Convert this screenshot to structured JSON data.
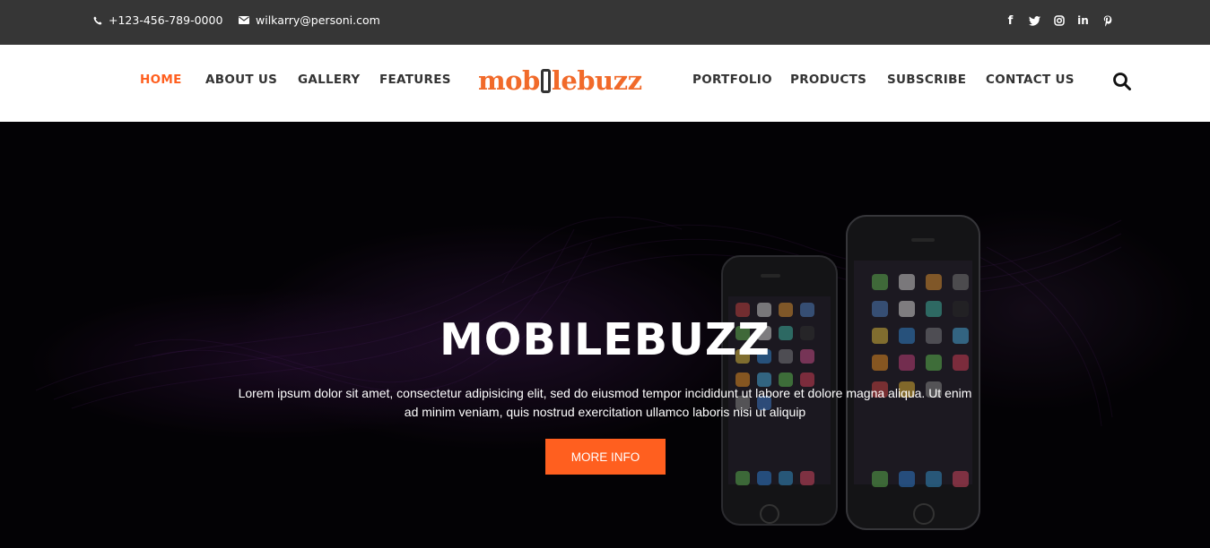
{
  "topbar": {
    "phone": "+123-456-789-0000",
    "email": "wilkarry@personi.com",
    "socials": [
      "facebook-icon",
      "twitter-icon",
      "instagram-icon",
      "linkedin-icon",
      "pinterest-icon"
    ],
    "background": "#363636"
  },
  "nav": {
    "left_items": [
      "HOME",
      "ABOUT US",
      "GALLERY",
      "FEATURES"
    ],
    "right_items": [
      "PORTFOLIO",
      "PRODUCTS",
      "SUBSCRIBE",
      "CONTACT US"
    ],
    "active": "HOME",
    "logo_left": "mob",
    "logo_right": "lebuzz",
    "search_icon": "search-icon"
  },
  "hero": {
    "title": "MOBILEBUZZ",
    "text_line1": "Lorem ipsum dolor sit amet, consectetur adipisicing elit, sed do eiusmod tempor incididunt ut labore et dolore magna aliqua. Ut enim",
    "text_line2": "ad minim veniam, quis nostrud exercitation ullamco laboris nisi ut aliquip",
    "button": "MORE INFO"
  },
  "colors": {
    "accent": "#ff5f1f",
    "logo": "#f16a2a",
    "nav_text": "#333333",
    "hero_background": "#050307"
  }
}
